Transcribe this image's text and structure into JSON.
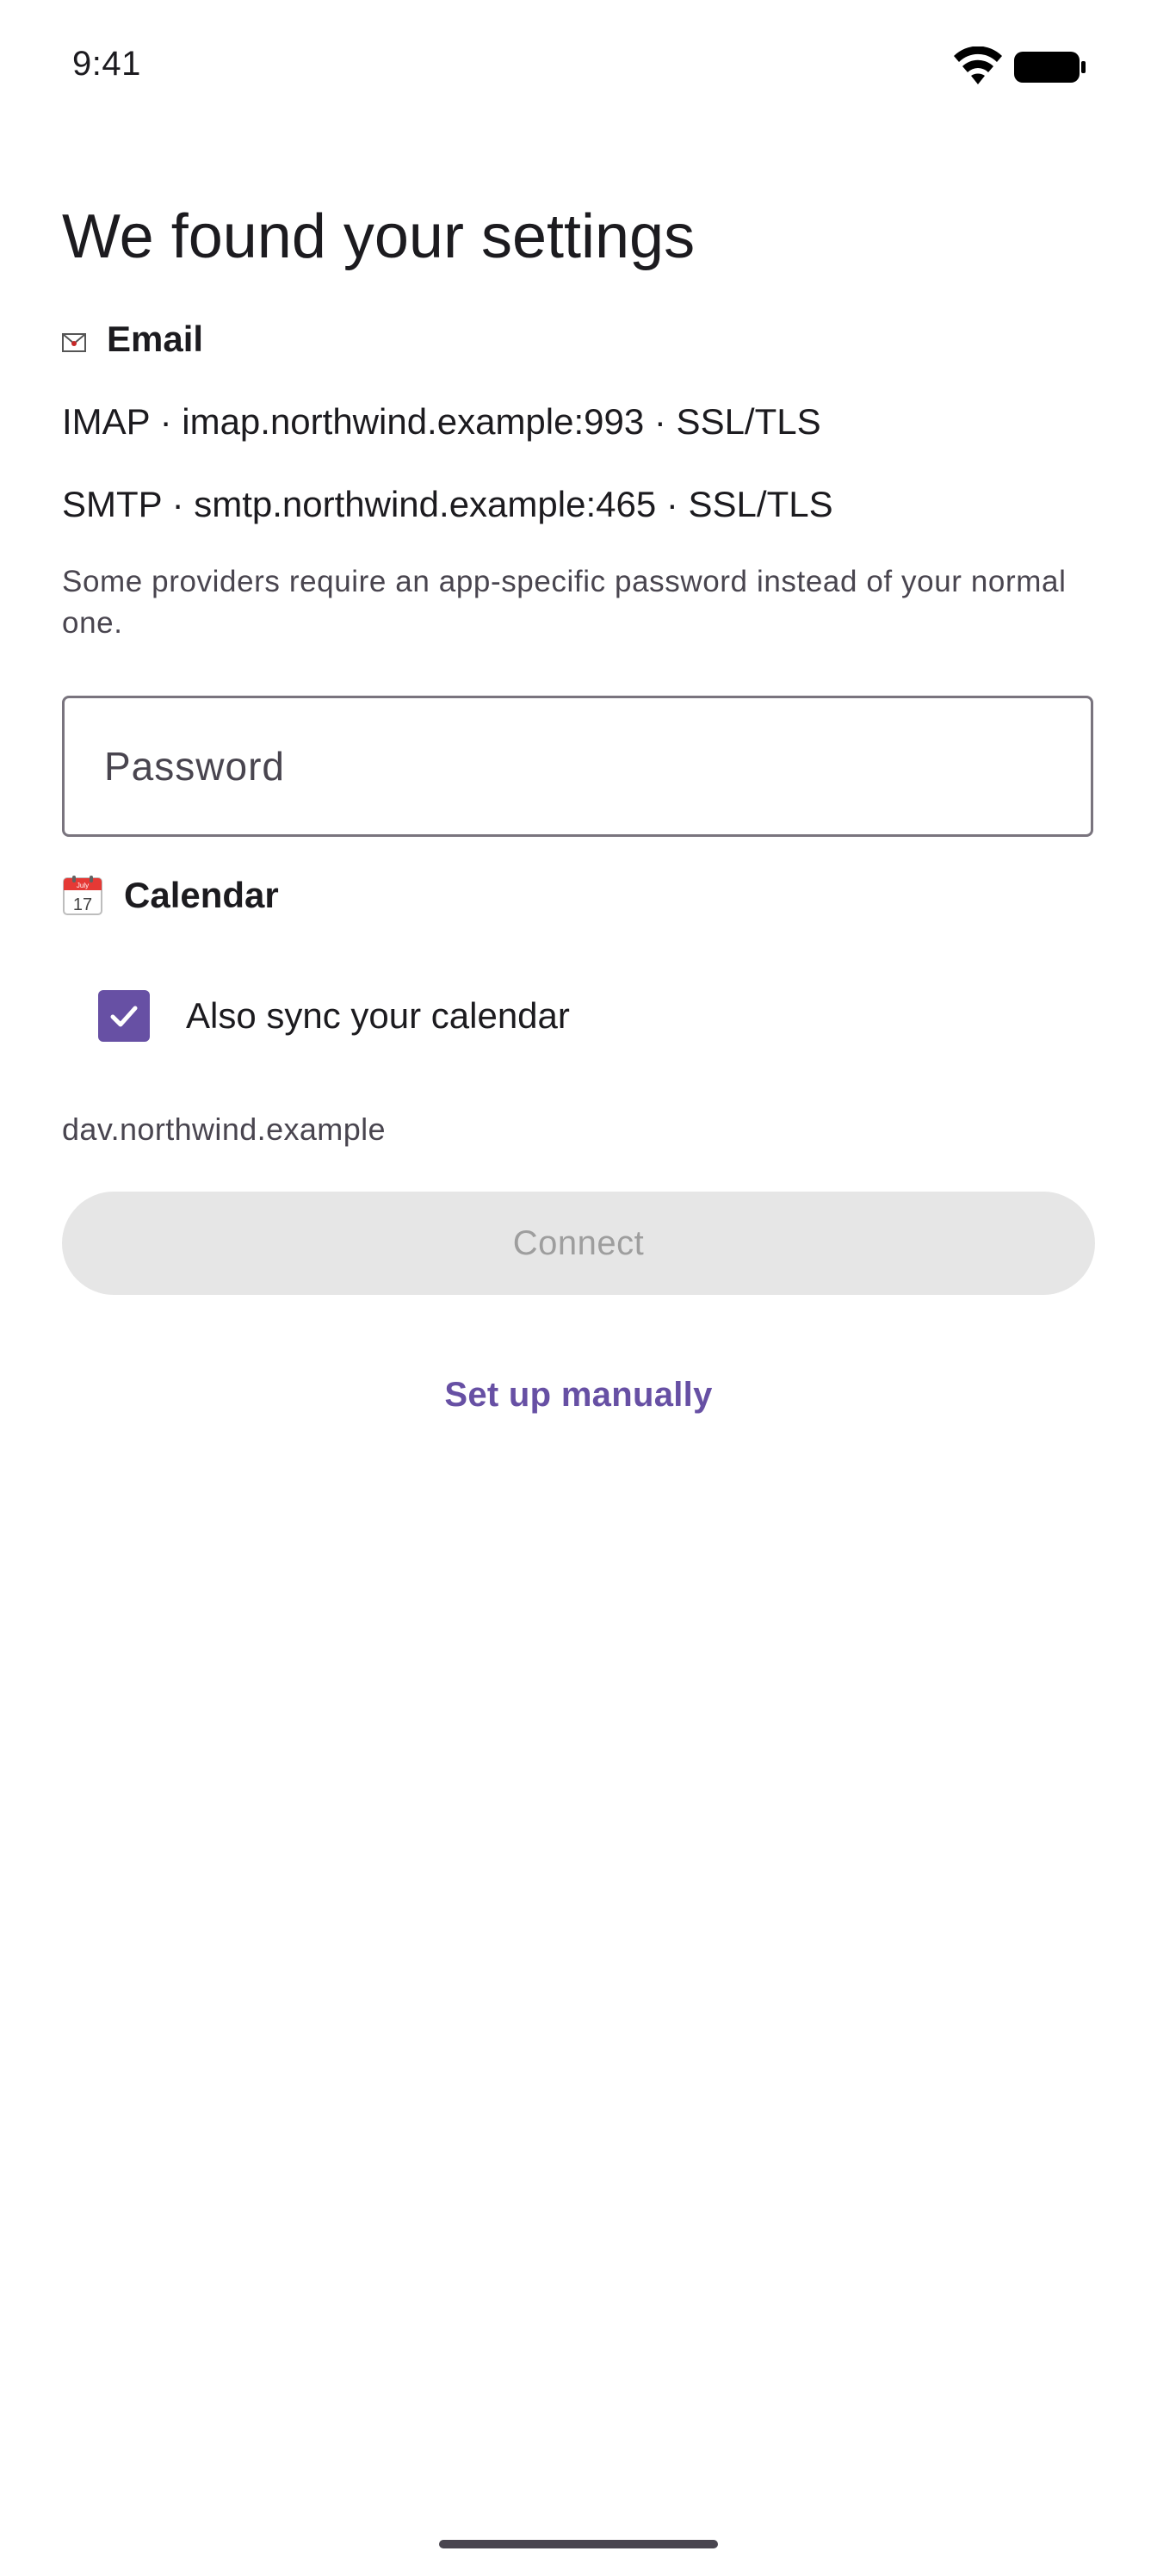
{
  "status_bar": {
    "time": "9:41",
    "icons": [
      "wifi-icon",
      "battery-icon"
    ]
  },
  "page": {
    "title": "We found your settings"
  },
  "email_section": {
    "icon": "envelope-icon",
    "label": "Email",
    "imap": "IMAP · imap.northwind.example:993 · SSL/TLS",
    "smtp": "SMTP · smtp.northwind.example:465 · SSL/TLS",
    "hint": "Some providers require an app-specific password instead of your normal one."
  },
  "password_field": {
    "placeholder": "Password",
    "value": ""
  },
  "calendar_section": {
    "icon": "calendar-icon",
    "icon_day": "17",
    "icon_month": "July",
    "label": "Calendar",
    "sync_checkbox_label": "Also sync your calendar",
    "sync_checked": true,
    "dav_host": "dav.northwind.example"
  },
  "actions": {
    "connect_label": "Connect",
    "connect_enabled": false,
    "manual_setup_label": "Set up manually"
  },
  "colors": {
    "accent": "#6750a4",
    "text_primary": "#1c1b1f",
    "text_secondary": "#49454f",
    "outline": "#79747e",
    "disabled_container": "#e6e6e6",
    "disabled_text": "#9e9e9e"
  }
}
